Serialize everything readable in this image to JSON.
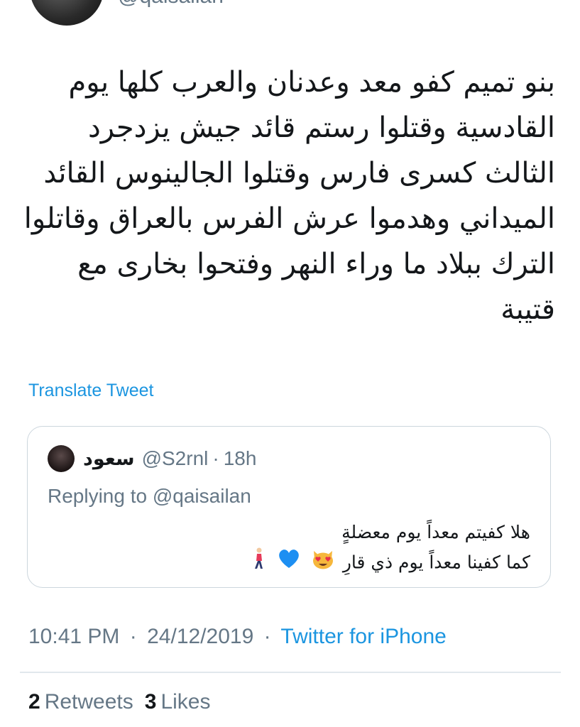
{
  "author": {
    "handle": "@qaisailan"
  },
  "tweet": {
    "text": "بنو تميم كفو معد وعدنان والعرب كلها يوم\nالقادسية وقتلوا رستم قائد جيش يزدجرد\nالثالث كسرى فارس وقتلوا الجالينوس القائد\nالميداني وهدموا عرش الفرس بالعراق وقاتلوا\nالترك ببلاد ما وراء النهر وفتحوا بخارى مع\nقتيبة",
    "translate_label": "Translate Tweet"
  },
  "quote": {
    "name": "سعود",
    "handle": "@S2rnl",
    "separator": "·",
    "time": "18h",
    "replying_to": "Replying to @qaisailan",
    "line1": "هلا كفيتم معداً يوم معضلةٍ",
    "line2": "كما كفينا معداً يوم ذي قارِ",
    "emojis": [
      "smiling-cat-heart-eyes-icon",
      "blue-heart-icon",
      "person-walking-icon"
    ]
  },
  "meta": {
    "time": "10:41 PM",
    "date": "24/12/2019",
    "separator": "·",
    "source": "Twitter for iPhone"
  },
  "stats": {
    "retweets_count": "2",
    "retweets_label": "Retweets",
    "likes_count": "3",
    "likes_label": "Likes"
  },
  "colors": {
    "link": "#1b95e0",
    "secondary_text": "#657786",
    "border": "#ccd6dd",
    "divider": "#e1e8ed",
    "heart": "#1d8ff2",
    "cat": "#f6b73c"
  }
}
